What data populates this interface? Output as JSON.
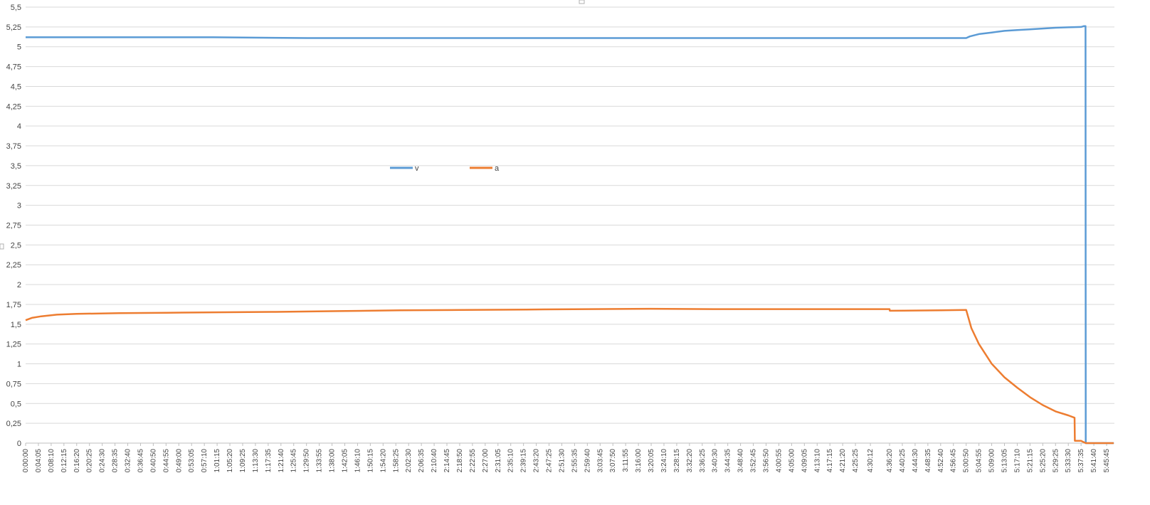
{
  "chart_data": {
    "type": "line",
    "title": "",
    "xlabel": "",
    "ylabel": "",
    "ylim": [
      0,
      5.5
    ],
    "y_ticks": [
      "0",
      "0,25",
      "0,5",
      "0,75",
      "1",
      "1,25",
      "1,5",
      "1,75",
      "2",
      "2,25",
      "2,5",
      "2,75",
      "3",
      "3,25",
      "3,5",
      "3,75",
      "4",
      "4,25",
      "4,5",
      "4,75",
      "5",
      "5,25",
      "5,5"
    ],
    "x_tick_labels": [
      "0:00:00",
      "0:04:05",
      "0:08:10",
      "0:12:15",
      "0:16:20",
      "0:20:25",
      "0:24:30",
      "0:28:35",
      "0:32:40",
      "0:36:45",
      "0:40:50",
      "0:44:55",
      "0:49:00",
      "0:53:05",
      "0:57:10",
      "1:01:15",
      "1:05:20",
      "1:09:25",
      "1:13:30",
      "1:17:35",
      "1:21:40",
      "1:25:45",
      "1:29:50",
      "1:33:55",
      "1:38:00",
      "1:42:05",
      "1:46:10",
      "1:50:15",
      "1:54:20",
      "1:58:25",
      "2:02:30",
      "2:06:35",
      "2:10:40",
      "2:14:45",
      "2:18:50",
      "2:22:55",
      "2:27:00",
      "2:31:05",
      "2:35:10",
      "2:39:15",
      "2:43:20",
      "2:47:25",
      "2:51:30",
      "2:55:35",
      "2:59:40",
      "3:03:45",
      "3:07:50",
      "3:11:55",
      "3:16:00",
      "3:20:05",
      "3:24:10",
      "3:28:15",
      "3:32:20",
      "3:36:25",
      "3:40:30",
      "3:44:35",
      "3:48:40",
      "3:52:45",
      "3:56:50",
      "4:00:55",
      "4:05:00",
      "4:09:05",
      "4:13:10",
      "4:17:15",
      "4:21:20",
      "4:25:25",
      "4:30:12",
      "4:36:20",
      "4:40:25",
      "4:44:30",
      "4:48:35",
      "4:52:40",
      "4:56:45",
      "5:00:50",
      "5:04:55",
      "5:09:00",
      "5:13:05",
      "5:17:10",
      "5:21:15",
      "5:25:20",
      "5:29:25",
      "5:33:30",
      "5:37:35",
      "5:41:40",
      "5:45:45"
    ],
    "grid": true,
    "legend_position": "top-center",
    "series": [
      {
        "name": "v",
        "color": "#5B9BD5",
        "points": [
          [
            "0:00:00",
            5.12
          ],
          [
            "0:30:00",
            5.12
          ],
          [
            "1:00:00",
            5.12
          ],
          [
            "1:30:00",
            5.11
          ],
          [
            "2:00:00",
            5.11
          ],
          [
            "2:30:00",
            5.11
          ],
          [
            "3:00:00",
            5.11
          ],
          [
            "3:30:00",
            5.11
          ],
          [
            "4:00:00",
            5.11
          ],
          [
            "4:40:25",
            5.11
          ],
          [
            "5:00:50",
            5.11
          ],
          [
            "5:02:00",
            5.13
          ],
          [
            "5:04:55",
            5.16
          ],
          [
            "5:09:00",
            5.18
          ],
          [
            "5:13:05",
            5.2
          ],
          [
            "5:17:10",
            5.21
          ],
          [
            "5:21:15",
            5.22
          ],
          [
            "5:25:20",
            5.23
          ],
          [
            "5:29:25",
            5.24
          ],
          [
            "5:33:30",
            5.245
          ],
          [
            "5:37:35",
            5.25
          ],
          [
            "5:38:30",
            5.26
          ],
          [
            "5:39:00",
            5.26
          ],
          [
            "5:39:05",
            0
          ],
          [
            "5:48:00",
            0
          ]
        ]
      },
      {
        "name": "a",
        "color": "#ED7D31",
        "points": [
          [
            "0:00:00",
            1.55
          ],
          [
            "0:02:00",
            1.58
          ],
          [
            "0:05:00",
            1.6
          ],
          [
            "0:10:00",
            1.62
          ],
          [
            "0:16:20",
            1.63
          ],
          [
            "0:30:00",
            1.64
          ],
          [
            "0:45:00",
            1.645
          ],
          [
            "1:00:00",
            1.65
          ],
          [
            "1:20:00",
            1.655
          ],
          [
            "1:40:00",
            1.665
          ],
          [
            "2:00:00",
            1.675
          ],
          [
            "2:20:00",
            1.68
          ],
          [
            "2:40:00",
            1.685
          ],
          [
            "3:00:00",
            1.69
          ],
          [
            "3:20:00",
            1.695
          ],
          [
            "3:40:00",
            1.69
          ],
          [
            "4:00:00",
            1.69
          ],
          [
            "4:36:20",
            1.69
          ],
          [
            "4:36:25",
            1.67
          ],
          [
            "4:52:40",
            1.675
          ],
          [
            "5:00:50",
            1.68
          ],
          [
            "5:02:30",
            1.45
          ],
          [
            "5:04:55",
            1.25
          ],
          [
            "5:09:00",
            1.0
          ],
          [
            "5:13:05",
            0.83
          ],
          [
            "5:17:10",
            0.7
          ],
          [
            "5:21:15",
            0.58
          ],
          [
            "5:25:20",
            0.48
          ],
          [
            "5:29:25",
            0.4
          ],
          [
            "5:33:30",
            0.35
          ],
          [
            "5:35:30",
            0.32
          ],
          [
            "5:35:35",
            0.03
          ],
          [
            "5:37:35",
            0.03
          ],
          [
            "5:38:00",
            0.02
          ],
          [
            "5:39:05",
            0.0
          ],
          [
            "5:48:00",
            0.0
          ]
        ]
      }
    ]
  }
}
